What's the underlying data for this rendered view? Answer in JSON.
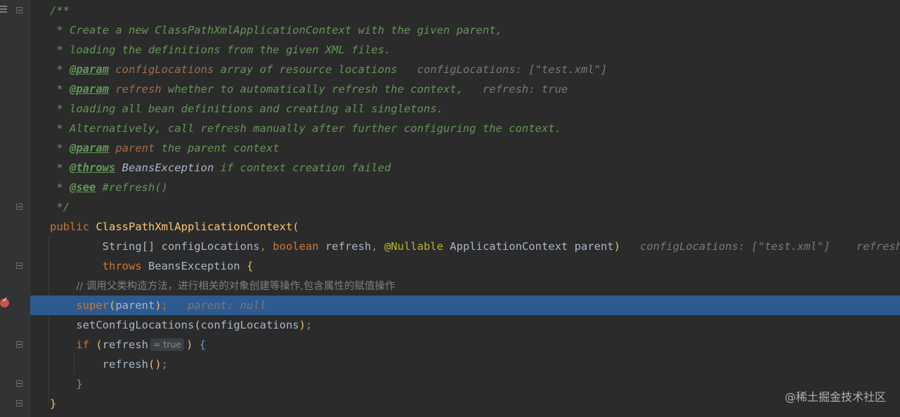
{
  "editor": {
    "lines": [
      [
        {
          "c": "doc",
          "t": "/**"
        }
      ],
      [
        {
          "c": "doc",
          "t": " * Create a new ClassPathXmlApplicationContext with the given parent,"
        }
      ],
      [
        {
          "c": "doc",
          "t": " * loading the definitions from the given XML files."
        }
      ],
      [
        {
          "c": "doc",
          "t": " * "
        },
        {
          "c": "tag",
          "t": "@param"
        },
        {
          "c": "pname",
          "t": " configLocations"
        },
        {
          "c": "doc",
          "t": " array of resource locations  "
        },
        {
          "c": "hint",
          "t": " configLocations: [\"test.xml\"]"
        }
      ],
      [
        {
          "c": "doc",
          "t": " * "
        },
        {
          "c": "tag",
          "t": "@param"
        },
        {
          "c": "pname",
          "t": " refresh"
        },
        {
          "c": "doc",
          "t": " whether to automatically refresh the context,  "
        },
        {
          "c": "hint",
          "t": " refresh: true"
        }
      ],
      [
        {
          "c": "doc",
          "t": " * loading all bean definitions and creating all singletons."
        }
      ],
      [
        {
          "c": "doc",
          "t": " * Alternatively, call refresh manually after further configuring the context."
        }
      ],
      [
        {
          "c": "doc",
          "t": " * "
        },
        {
          "c": "tag",
          "t": "@param"
        },
        {
          "c": "pname",
          "t": " parent"
        },
        {
          "c": "doc",
          "t": " the parent context"
        }
      ],
      [
        {
          "c": "doc",
          "t": " * "
        },
        {
          "c": "tag",
          "t": "@throws"
        },
        {
          "c": "ref",
          "t": " BeansException"
        },
        {
          "c": "doc",
          "t": " if context creation failed"
        }
      ],
      [
        {
          "c": "doc",
          "t": " * "
        },
        {
          "c": "tag",
          "t": "@see"
        },
        {
          "c": "doc",
          "t": " #refresh()"
        }
      ],
      [
        {
          "c": "doc",
          "t": " */"
        }
      ],
      [
        {
          "c": "kw",
          "t": "public "
        },
        {
          "c": "fn",
          "t": "ClassPathXmlApplicationContext"
        },
        {
          "c": "brace",
          "t": "("
        }
      ],
      [
        {
          "c": "plain",
          "t": "        String[] configLocations"
        },
        {
          "c": "kw",
          "t": ", boolean "
        },
        {
          "c": "plain",
          "t": "refresh"
        },
        {
          "c": "kw",
          "t": ", "
        },
        {
          "c": "ann",
          "t": "@Nullable "
        },
        {
          "c": "plain",
          "t": "ApplicationContext parent"
        },
        {
          "c": "brace",
          "t": ")"
        },
        {
          "c": "hint",
          "t": "   configLocations: [\"test.xml\"]    refresh: true"
        }
      ],
      [
        {
          "c": "kw",
          "t": "        throws "
        },
        {
          "c": "plain",
          "t": "BeansException "
        },
        {
          "c": "brace",
          "t": "{"
        }
      ],
      [
        {
          "c": "plain",
          "t": "    "
        },
        {
          "c": "cmt",
          "t": "// 调用父类构造方法，进行相关的对象创建等操作,包含属性的赋值操作"
        }
      ],
      [
        {
          "c": "kw",
          "t": "    super"
        },
        {
          "c": "brace",
          "t": "("
        },
        {
          "c": "plain",
          "t": "parent"
        },
        {
          "c": "brace",
          "t": ")"
        },
        {
          "c": "kw",
          "t": ";"
        },
        {
          "c": "hint",
          "t": "   parent: null"
        }
      ],
      [
        {
          "c": "plain",
          "t": "    setConfigLocations"
        },
        {
          "c": "brace",
          "t": "("
        },
        {
          "c": "plain",
          "t": "configLocations"
        },
        {
          "c": "brace",
          "t": ")"
        },
        {
          "c": "kw",
          "t": ";"
        }
      ],
      [
        {
          "c": "kw",
          "t": "    if "
        },
        {
          "c": "brace",
          "t": "("
        },
        {
          "c": "plain",
          "t": "refresh"
        },
        {
          "c": "inlay",
          "t": "= true"
        },
        {
          "c": "brace",
          "t": ")"
        },
        {
          "c": "plain",
          "t": " "
        },
        {
          "c": "blue",
          "t": "{"
        }
      ],
      [
        {
          "c": "plain",
          "t": "        refresh"
        },
        {
          "c": "brace",
          "t": "()"
        },
        {
          "c": "kw",
          "t": ";"
        }
      ],
      [
        {
          "c": "blue",
          "t": "    }"
        }
      ],
      [
        {
          "c": "brace",
          "t": "}"
        }
      ]
    ],
    "highlighted_line": 15
  },
  "watermark": "@稀土掘金技术社区"
}
